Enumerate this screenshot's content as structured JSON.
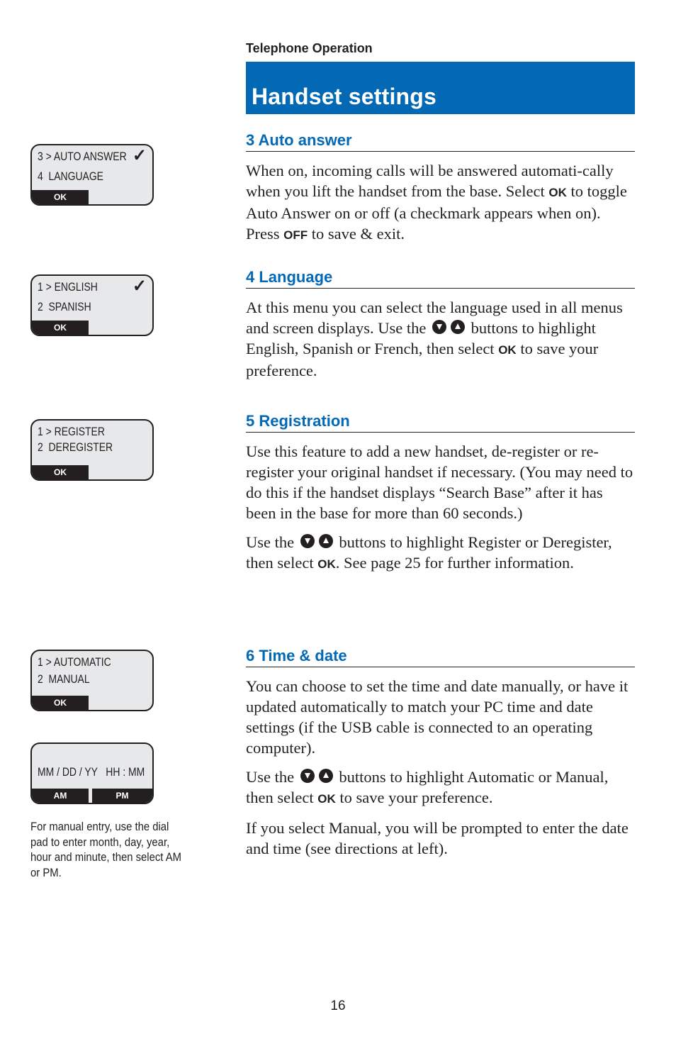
{
  "running_head": "Telephone Operation",
  "title": "Handset settings",
  "accent_color": "#0369b5",
  "sections": [
    {
      "heading": "3 Auto answer",
      "p1": {
        "t1": "When on, incoming calls will be answered automati-cally when you lift the handset from the base. Select ",
        "k1": "OK",
        "t2": " to toggle Auto Answer on or off (a checkmark appears when on). Press ",
        "k2": "OFF",
        "t3": " to save & exit."
      }
    },
    {
      "heading": "4 Language",
      "p1": {
        "t1": "At this menu you can select the language used in all menus and screen displays. Use the ",
        "t2": " buttons to highlight English, Spanish or French, then select ",
        "k1": "OK",
        "t3": " to save your preference."
      }
    },
    {
      "heading": "5 Registration",
      "p1": "Use this feature to add a new handset, de-register or re-register your original handset if necessary. (You may need to do this if the handset displays “Search Base” after it has been in the base for more than 60 seconds.)",
      "p2": {
        "t1": "Use the ",
        "t2": " buttons to highlight Register or Deregister, then select ",
        "k1": "OK",
        "t3": ". See page 25 for further information."
      }
    },
    {
      "heading": "6 Time & date",
      "p1": "You can choose to set the time and date manually, or have it updated automatically to match your PC time and date settings (if the USB cable is connected to an operating computer).",
      "p2": {
        "t1": "Use the ",
        "t2": " buttons to highlight Automatic or Manual, then select ",
        "k1": "OK",
        "t3": " to save your preference."
      },
      "p3": "If you select Manual, you will be prompted to enter the date and time (see directions at left)."
    }
  ],
  "icons": {
    "down": "down-arrow-button-icon",
    "up": "up-arrow-button-icon",
    "check": "✓"
  },
  "screens": [
    {
      "line1": "3 > AUTO ANSWER",
      "line2": "4  LANGUAGE",
      "checked": true,
      "softkey": "OK"
    },
    {
      "line1": "1 > ENGLISH",
      "line2": "2  SPANISH",
      "checked": true,
      "softkey": "OK"
    },
    {
      "line1": "1 > REGISTER",
      "line2": "2  DEREGISTER",
      "checked": false,
      "softkey": "OK"
    },
    {
      "line1": "1 > AUTOMATIC",
      "line2": "2  MANUAL",
      "checked": false,
      "softkey": "OK"
    },
    {
      "line1": "MM / DD / YY   HH : MM",
      "softkey_left": "AM",
      "softkey_right": "PM"
    }
  ],
  "caption": "For manual entry, use the dial pad to enter month, day, year, hour and minute, then select AM or PM.",
  "page_number": "16"
}
